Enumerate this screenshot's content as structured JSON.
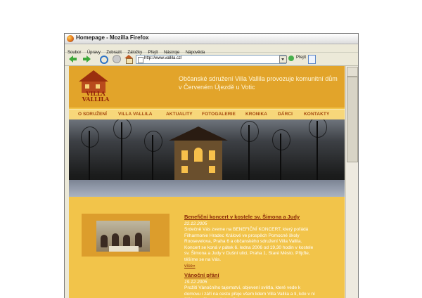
{
  "window": {
    "title": "Homepage - Mozilla Firefox"
  },
  "menu": [
    "Soubor",
    "Úpravy",
    "Zobrazit",
    "Záložky",
    "Přejít",
    "Nástroje",
    "Nápověda"
  ],
  "navbar": {
    "url": "http://www.vallila.cz/",
    "go_label": "Přejít"
  },
  "site": {
    "logo_text": "VILLA VALLILA",
    "tagline": "Občanské sdružení Villa Vallila provozuje komunitní dům v Červeném Újezdě u Votic",
    "nav": [
      "O SDRUŽENÍ",
      "VILLA VALLILA",
      "AKTUALITY",
      "FOTOGALERIE",
      "KRONIKA",
      "DÁRCI",
      "KONTAKTY"
    ],
    "news": [
      {
        "title": "Benefiční koncert v kostele sv. Šimona a Judy",
        "date": "22.12.2005",
        "body": "Srdečně Vás zveme na BENEFIČNÍ KONCERT, který pořádá Filharmonie Hradec Králové ve prospěch Pomocné školy Roosevelova, Praha 6 a občanského sdružení Villa Vallila. Koncert se koná v pátek 6. ledna 2006 od 19,30 hodin v kostele sv. Šimona a Judy v Dušní ulici, Praha 1, Staré Město. Přijďte, těšíme se na Vás.",
        "more": "více»"
      },
      {
        "title": "Vánoční přání",
        "date": "19.12.2005",
        "body": "Prožití Vánočního tajemství, objevení světla, které vede k domovu i září na cestu přeje všem lidem Villa Vallila a ti, kdo v ní žijí i se o život v ní starají."
      }
    ]
  }
}
